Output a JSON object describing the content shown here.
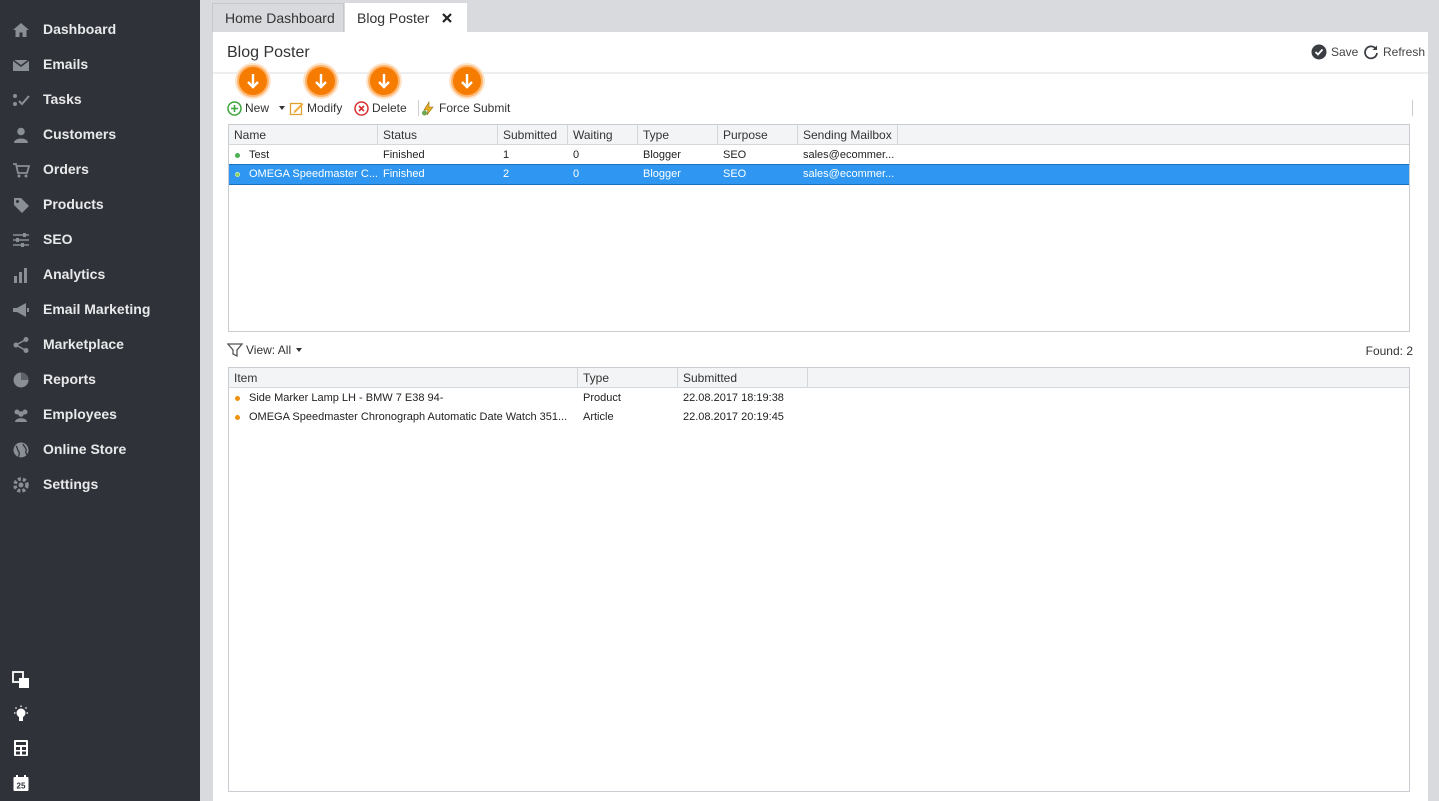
{
  "sidebar": {
    "items": [
      {
        "label": "Dashboard",
        "icon": "home-icon"
      },
      {
        "label": "Emails",
        "icon": "envelope-icon"
      },
      {
        "label": "Tasks",
        "icon": "tasks-icon"
      },
      {
        "label": "Customers",
        "icon": "user-icon"
      },
      {
        "label": "Orders",
        "icon": "cart-icon"
      },
      {
        "label": "Products",
        "icon": "tag-icon"
      },
      {
        "label": "SEO",
        "icon": "sliders-icon"
      },
      {
        "label": "Analytics",
        "icon": "bar-chart-icon"
      },
      {
        "label": "Email Marketing",
        "icon": "megaphone-icon"
      },
      {
        "label": "Marketplace",
        "icon": "share-icon"
      },
      {
        "label": "Reports",
        "icon": "pie-chart-icon"
      },
      {
        "label": "Employees",
        "icon": "users-icon"
      },
      {
        "label": "Online Store",
        "icon": "globe-icon"
      },
      {
        "label": "Settings",
        "icon": "settings-icon"
      }
    ],
    "bottom_icons": [
      "windows-icon",
      "lightbulb-icon",
      "calculator-icon",
      "calendar-icon"
    ],
    "calendar_day": "25"
  },
  "tabs": {
    "home": "Home Dashboard",
    "blog": "Blog Poster"
  },
  "page": {
    "title": "Blog Poster",
    "save_label": "Save",
    "refresh_label": "Refresh"
  },
  "toolbar": {
    "new_label": "New",
    "modify_label": "Modify",
    "delete_label": "Delete",
    "force_submit_label": "Force Submit"
  },
  "posters_grid": {
    "columns": [
      "Name",
      "Status",
      "Submitted",
      "Waiting",
      "Type",
      "Purpose",
      "Sending Mailbox"
    ],
    "rows": [
      {
        "name": "Test",
        "status": "Finished",
        "submitted": "1",
        "waiting": "0",
        "type": "Blogger",
        "purpose": "SEO",
        "mailbox": "sales@ecommer...",
        "selected": false
      },
      {
        "name": "OMEGA Speedmaster C...",
        "status": "Finished",
        "submitted": "2",
        "waiting": "0",
        "type": "Blogger",
        "purpose": "SEO",
        "mailbox": "sales@ecommer...",
        "selected": true
      }
    ]
  },
  "filter": {
    "view_label": "View: All",
    "found_label": "Found: 2"
  },
  "items_grid": {
    "columns": [
      "Item",
      "Type",
      "Submitted"
    ],
    "rows": [
      {
        "item": "Side Marker Lamp LH - BMW 7 E38 94-",
        "type": "Product",
        "submitted": "22.08.2017 18:19:38"
      },
      {
        "item": "OMEGA Speedmaster Chronograph Automatic Date Watch 351...",
        "type": "Article",
        "submitted": "22.08.2017 20:19:45"
      }
    ]
  },
  "colors": {
    "sidebar_bg": "#2f3238",
    "accent_orange": "#f57c00",
    "selection_blue": "#2f97f2",
    "status_green": "#4caf50",
    "item_orange": "#f0900c"
  }
}
